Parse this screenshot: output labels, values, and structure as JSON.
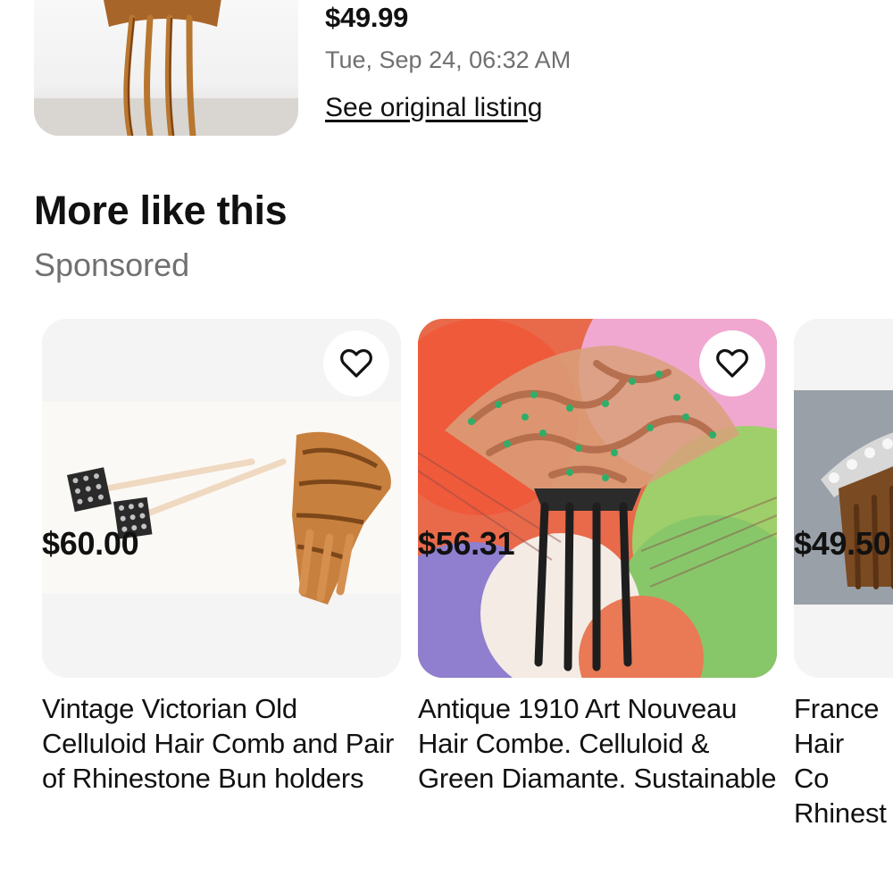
{
  "sold_listing": {
    "price": "$49.99",
    "date": "Tue, Sep 24, 06:32 AM",
    "link_label": "See original listing"
  },
  "section": {
    "title": "More like this",
    "subtitle": "Sponsored"
  },
  "items": [
    {
      "title": "Vintage Victorian Old Celluloid Hair Comb and Pair of Rhinestone Bun holders",
      "price": "$60.00",
      "watch_icon": "heart-outline-icon"
    },
    {
      "title": "Antique 1910 Art Nouveau Hair Combe. Celluloid & Green Diamante. Sustainable",
      "price": "$56.31",
      "watch_icon": "heart-outline-icon"
    },
    {
      "title": "France Hair Co Rhinest",
      "price": "$49.50",
      "watch_icon": "heart-outline-icon"
    }
  ],
  "colors": {
    "text_primary": "#111111",
    "text_secondary": "#707070",
    "card_background": "#f3f3f3"
  }
}
